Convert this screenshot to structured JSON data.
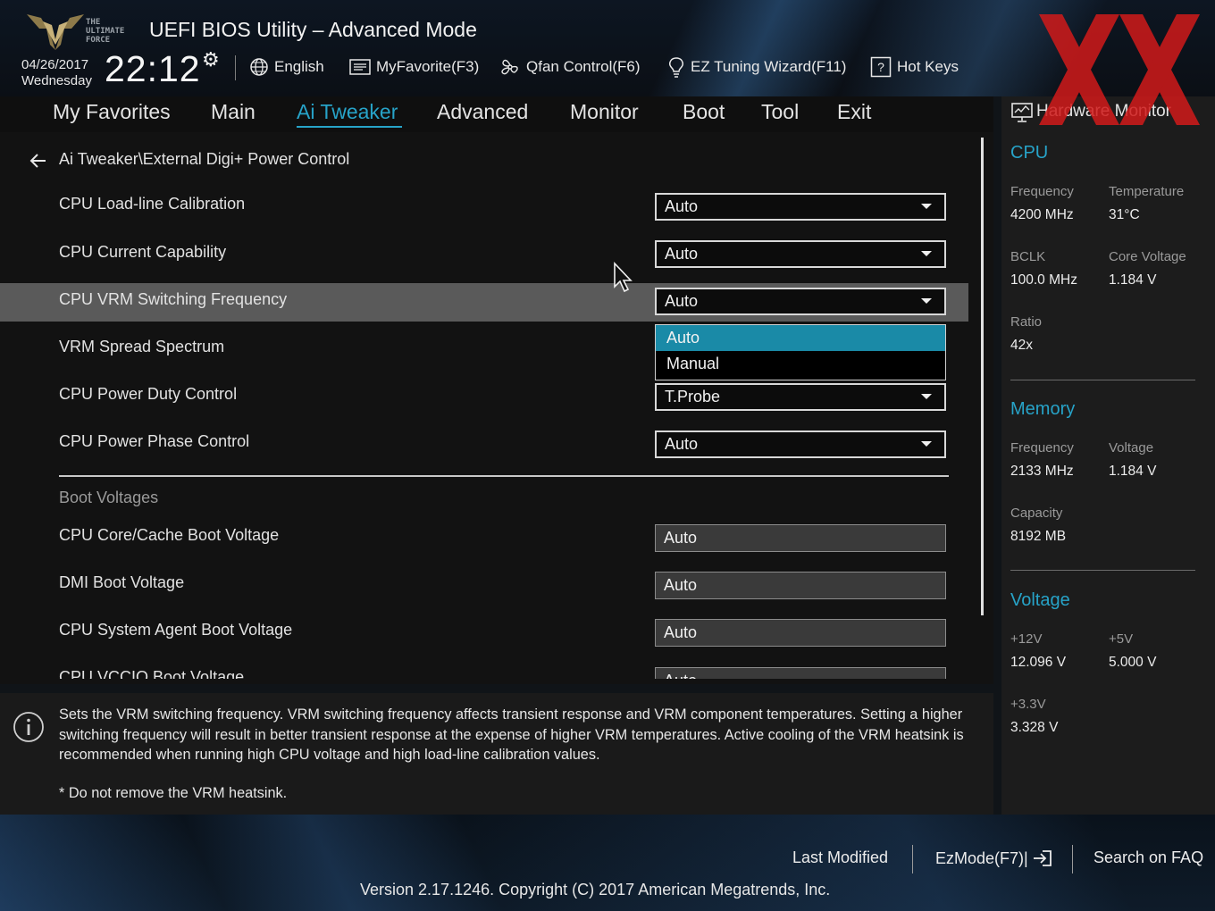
{
  "header": {
    "logo_text": [
      "THE",
      "ULTIMATE",
      "FORCE"
    ],
    "title": "UEFI BIOS Utility – Advanced Mode",
    "date": "04/26/2017",
    "day": "Wednesday",
    "time": "22:12",
    "tools": {
      "language": "English",
      "favorite": "MyFavorite(F3)",
      "qfan": "Qfan Control(F6)",
      "ez_tuning": "EZ Tuning Wizard(F11)",
      "hot_keys": "Hot Keys"
    }
  },
  "menu": {
    "items": [
      "My Favorites",
      "Main",
      "Ai Tweaker",
      "Advanced",
      "Monitor",
      "Boot",
      "Tool",
      "Exit"
    ],
    "active": "Ai Tweaker"
  },
  "breadcrumb": "Ai Tweaker\\External Digi+ Power Control",
  "settings": [
    {
      "label": "CPU Load-line Calibration",
      "value": "Auto"
    },
    {
      "label": "CPU Current Capability",
      "value": "Auto"
    },
    {
      "label": "CPU VRM Switching Frequency",
      "value": "Auto"
    },
    {
      "label": "VRM Spread Spectrum",
      "value": ""
    },
    {
      "label": "CPU Power Duty Control",
      "value": "T.Probe"
    },
    {
      "label": "CPU Power Phase Control",
      "value": "Auto"
    }
  ],
  "popup": {
    "options": [
      "Auto",
      "Manual"
    ],
    "selected": "Auto"
  },
  "boot_voltages": {
    "title": "Boot Voltages",
    "items": [
      {
        "label": "CPU Core/Cache Boot Voltage",
        "value": "Auto"
      },
      {
        "label": "DMI Boot Voltage",
        "value": "Auto"
      },
      {
        "label": "CPU System Agent Boot Voltage",
        "value": "Auto"
      },
      {
        "label": "CPU VCCIO Boot Voltage",
        "value": "Auto"
      }
    ]
  },
  "help": {
    "text": "Sets the VRM switching frequency.  VRM switching frequency affects transient response and VRM component temperatures. Setting a higher switching frequency will result in better transient response at the expense of higher VRM temperatures. Active cooling of the VRM heatsink is recommended when running high CPU voltage and high load-line calibration values.",
    "note": "* Do not remove the VRM heatsink."
  },
  "hardware_monitor": {
    "title": "Hardware Monitor",
    "cpu": {
      "title": "CPU",
      "frequency_label": "Frequency",
      "frequency": "4200 MHz",
      "temperature_label": "Temperature",
      "temperature": "31°C",
      "bclk_label": "BCLK",
      "bclk": "100.0 MHz",
      "core_voltage_label": "Core Voltage",
      "core_voltage": "1.184 V",
      "ratio_label": "Ratio",
      "ratio": "42x"
    },
    "memory": {
      "title": "Memory",
      "frequency_label": "Frequency",
      "frequency": "2133 MHz",
      "voltage_label": "Voltage",
      "voltage": "1.184 V",
      "capacity_label": "Capacity",
      "capacity": "8192 MB"
    },
    "voltage": {
      "title": "Voltage",
      "v12_label": "+12V",
      "v12": "12.096 V",
      "v5_label": "+5V",
      "v5": "5.000 V",
      "v33_label": "+3.3V",
      "v33": "3.328 V"
    }
  },
  "footer": {
    "last_modified": "Last Modified",
    "ezmode": "EzMode(F7)|",
    "search": "Search on FAQ",
    "version": "Version 2.17.1246. Copyright (C) 2017 American Megatrends, Inc."
  },
  "colors": {
    "accent": "#27a3c8",
    "selected_option": "#1a8aa7",
    "highlight_row": "#5a5a5a",
    "watermark": "#d11a1a"
  }
}
